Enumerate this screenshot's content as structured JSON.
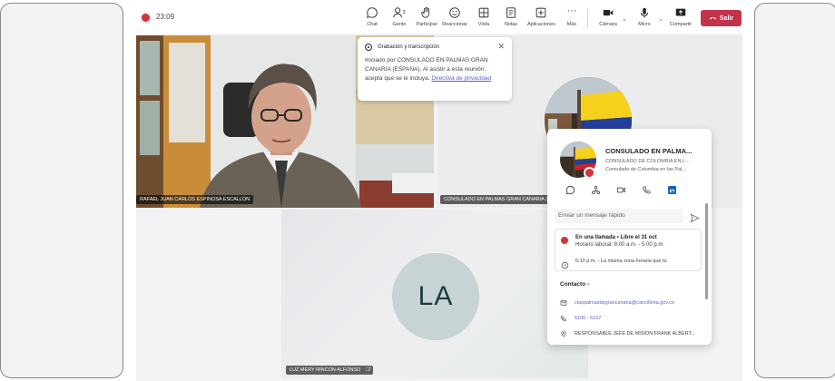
{
  "toolbar": {
    "timer": "23:09",
    "buttons": [
      {
        "id": "chat",
        "label": "Chat",
        "icon": "chat-icon"
      },
      {
        "id": "people",
        "label": "Gente",
        "icon": "people-icon",
        "count": "3"
      },
      {
        "id": "raise",
        "label": "Participar",
        "icon": "raise-hand-icon"
      },
      {
        "id": "react",
        "label": "Reaccionar",
        "icon": "smile-icon"
      },
      {
        "id": "view",
        "label": "Vista",
        "icon": "grid-icon"
      },
      {
        "id": "notes",
        "label": "Notas",
        "icon": "notes-icon"
      },
      {
        "id": "apps",
        "label": "Aplicaciones",
        "icon": "add-icon"
      },
      {
        "id": "more",
        "label": "Más",
        "icon": "more-icon"
      },
      {
        "id": "camera",
        "label": "Cámara",
        "icon": "camera-icon"
      },
      {
        "id": "mic",
        "label": "Micro",
        "icon": "mic-icon"
      },
      {
        "id": "share",
        "label": "Compartir",
        "icon": "share-icon"
      }
    ],
    "leave_label": "Salir",
    "leave_color": "#c4314b"
  },
  "participants": [
    {
      "name": "RAFAEL JUAN CARLOS ESPINOSA ESCALLON",
      "kind": "video"
    },
    {
      "name": "CONSULADO EN PALMAS GRAN CANARIA (ESPANA)",
      "kind": "avatar-image"
    },
    {
      "name": "LUZ MERY RINCON ALFONSO",
      "initials": "LA",
      "kind": "initials",
      "muted": true
    }
  ],
  "recording_popup": {
    "title": "Grabación y transcripción",
    "body": "Iniciado por CONSULADO EN PALMAS GRAN CANARIA (ESPANA). Al asistir a esta reunión, acepta que se le incluya.",
    "link": "Directiva de privacidad"
  },
  "contact_card": {
    "name": "CONSULADO EN PALMA...",
    "subtitle1": "CONSULADO DE COLOMBIA EN L...",
    "subtitle2": "Consulado de Colombia en las Pal...",
    "quick_message_placeholder": "Enviar un mensaje rápido",
    "status_title": "En una llamada • Libre el 31 oct",
    "status_hours": "Horario laboral: 8:00 a.m. - 5:00 p.m.",
    "local_time": "6:10 p.m. - La misma zona horaria que tú",
    "contact_header": "Contacto",
    "email": "claspalmasdegrancanaria@cancilleria.gov.co",
    "phone": "6106 - 6107",
    "role": "RESPONSABLE JEFE DE MISION FRANK ALBERT..."
  },
  "colors": {
    "presence_busy": "#d13438",
    "link": "#5b5fc7",
    "linkedin": "#0a66c2"
  }
}
